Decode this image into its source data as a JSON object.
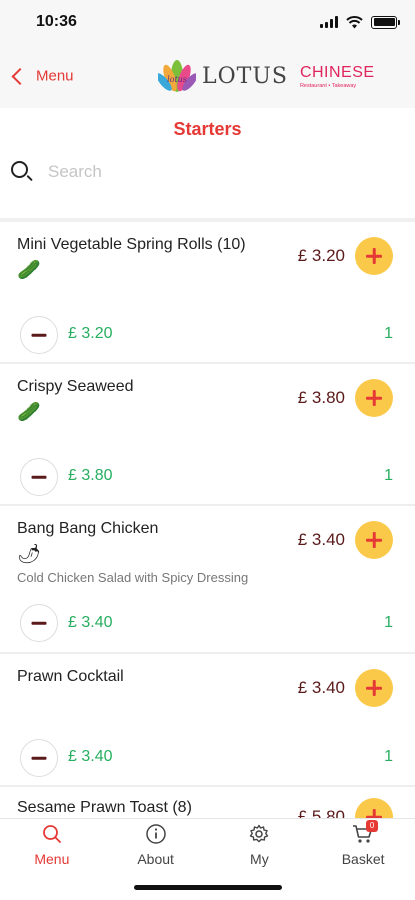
{
  "status_bar": {
    "time": "10:36"
  },
  "nav": {
    "back_label": "Menu",
    "logo_word": "LOTUS",
    "logo_chinese": "CHINESE",
    "logo_sub": "Restaurant • Takeaway"
  },
  "page_title": "Starters",
  "search": {
    "placeholder": "Search",
    "value": ""
  },
  "items": [
    {
      "name": "Mini Vegetable Spring Rolls (10)",
      "spice": "🥒",
      "desc": "",
      "price": "£ 3.20",
      "line_price": "£ 3.20",
      "qty": "1"
    },
    {
      "name": "Crispy Seaweed",
      "spice": "🥒",
      "desc": "",
      "price": "£ 3.80",
      "line_price": "£ 3.80",
      "qty": "1"
    },
    {
      "name": "Bang Bang Chicken",
      "spice": "🌶",
      "desc": "Cold Chicken Salad with Spicy Dressing",
      "price": "£ 3.40",
      "line_price": "£ 3.40",
      "qty": "1"
    },
    {
      "name": "Prawn Cocktail",
      "spice": "",
      "desc": "",
      "price": "£ 3.40",
      "line_price": "£ 3.40",
      "qty": "1"
    },
    {
      "name": "Sesame Prawn Toast (8)",
      "spice": "",
      "desc": "",
      "price": "£ 5.80",
      "line_price": "",
      "qty": ""
    }
  ],
  "tabs": [
    {
      "label": "Menu",
      "icon": "search-icon"
    },
    {
      "label": "About",
      "icon": "info-icon"
    },
    {
      "label": "My",
      "icon": "gear-icon"
    },
    {
      "label": "Basket",
      "icon": "cart-icon",
      "badge": "0"
    }
  ],
  "colors": {
    "accent": "#e53935",
    "add_button": "#fbc94a",
    "price": "#5a1a1a",
    "qty": "#27ae60"
  }
}
